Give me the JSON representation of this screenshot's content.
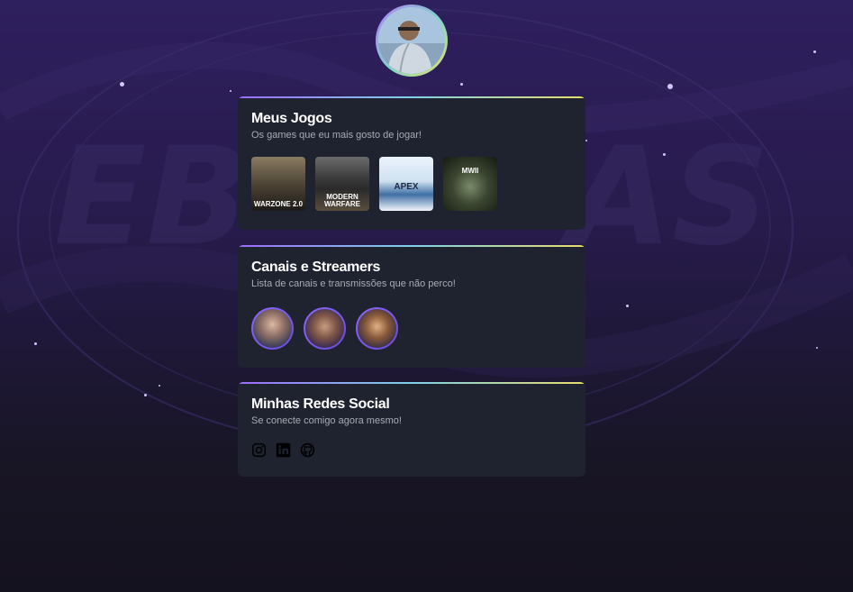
{
  "profile": {
    "avatar_alt": "Foto de perfil"
  },
  "colors": {
    "card_bg": "#1f2330",
    "accent_gradient": [
      "#9b6cff",
      "#7fd1e6",
      "#e9dc6c"
    ],
    "text_muted": "#a9abb4"
  },
  "sections": {
    "games": {
      "title": "Meus Jogos",
      "subtitle": "Os games que eu mais gosto de jogar!",
      "items": [
        {
          "name": "Call of Duty Warzone 2.0",
          "caption": "WARZONE 2.0"
        },
        {
          "name": "Call of Duty Modern Warfare",
          "caption": "MODERN WARFARE"
        },
        {
          "name": "Apex Legends",
          "caption": "APEX"
        },
        {
          "name": "Modern Warfare II",
          "caption": "MWII"
        }
      ]
    },
    "streamers": {
      "title": "Canais e Streamers",
      "subtitle": "Lista de canais e transmissões que não perco!",
      "items": [
        {
          "icon": "streamer-avatar-1"
        },
        {
          "icon": "streamer-avatar-2"
        },
        {
          "icon": "streamer-avatar-3"
        }
      ]
    },
    "social": {
      "title": "Minhas Redes Social",
      "subtitle": "Se conecte comigo agora mesmo!",
      "items": [
        {
          "icon": "instagram-icon"
        },
        {
          "icon": "linkedin-icon"
        },
        {
          "icon": "github-icon"
        }
      ]
    }
  }
}
